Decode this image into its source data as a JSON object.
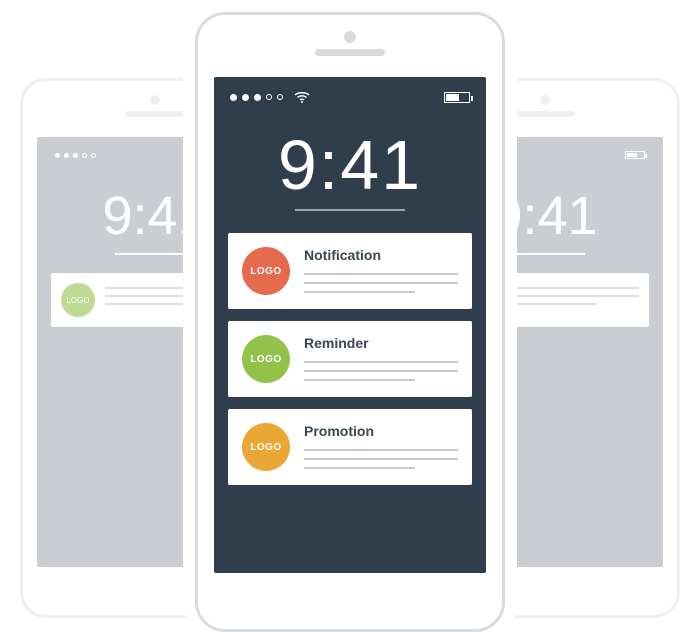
{
  "clock": {
    "time": "9:41"
  },
  "status": {
    "signal_filled": 3,
    "signal_empty": 2
  },
  "notifications": [
    {
      "title": "Notification",
      "logo_text": "LOGO",
      "color": "#e66a4e"
    },
    {
      "title": "Reminder",
      "logo_text": "LOGO",
      "color": "#93c24a"
    },
    {
      "title": "Promotion",
      "logo_text": "LOGO",
      "color": "#eaa735"
    }
  ],
  "bg_phone": {
    "time": "9:41",
    "card": {
      "logo_text": "LOGO",
      "color": "#93c24a"
    }
  },
  "colors": {
    "screen_bg": "#2f3d4c",
    "bg_screen_bg": "#a7afb5"
  }
}
